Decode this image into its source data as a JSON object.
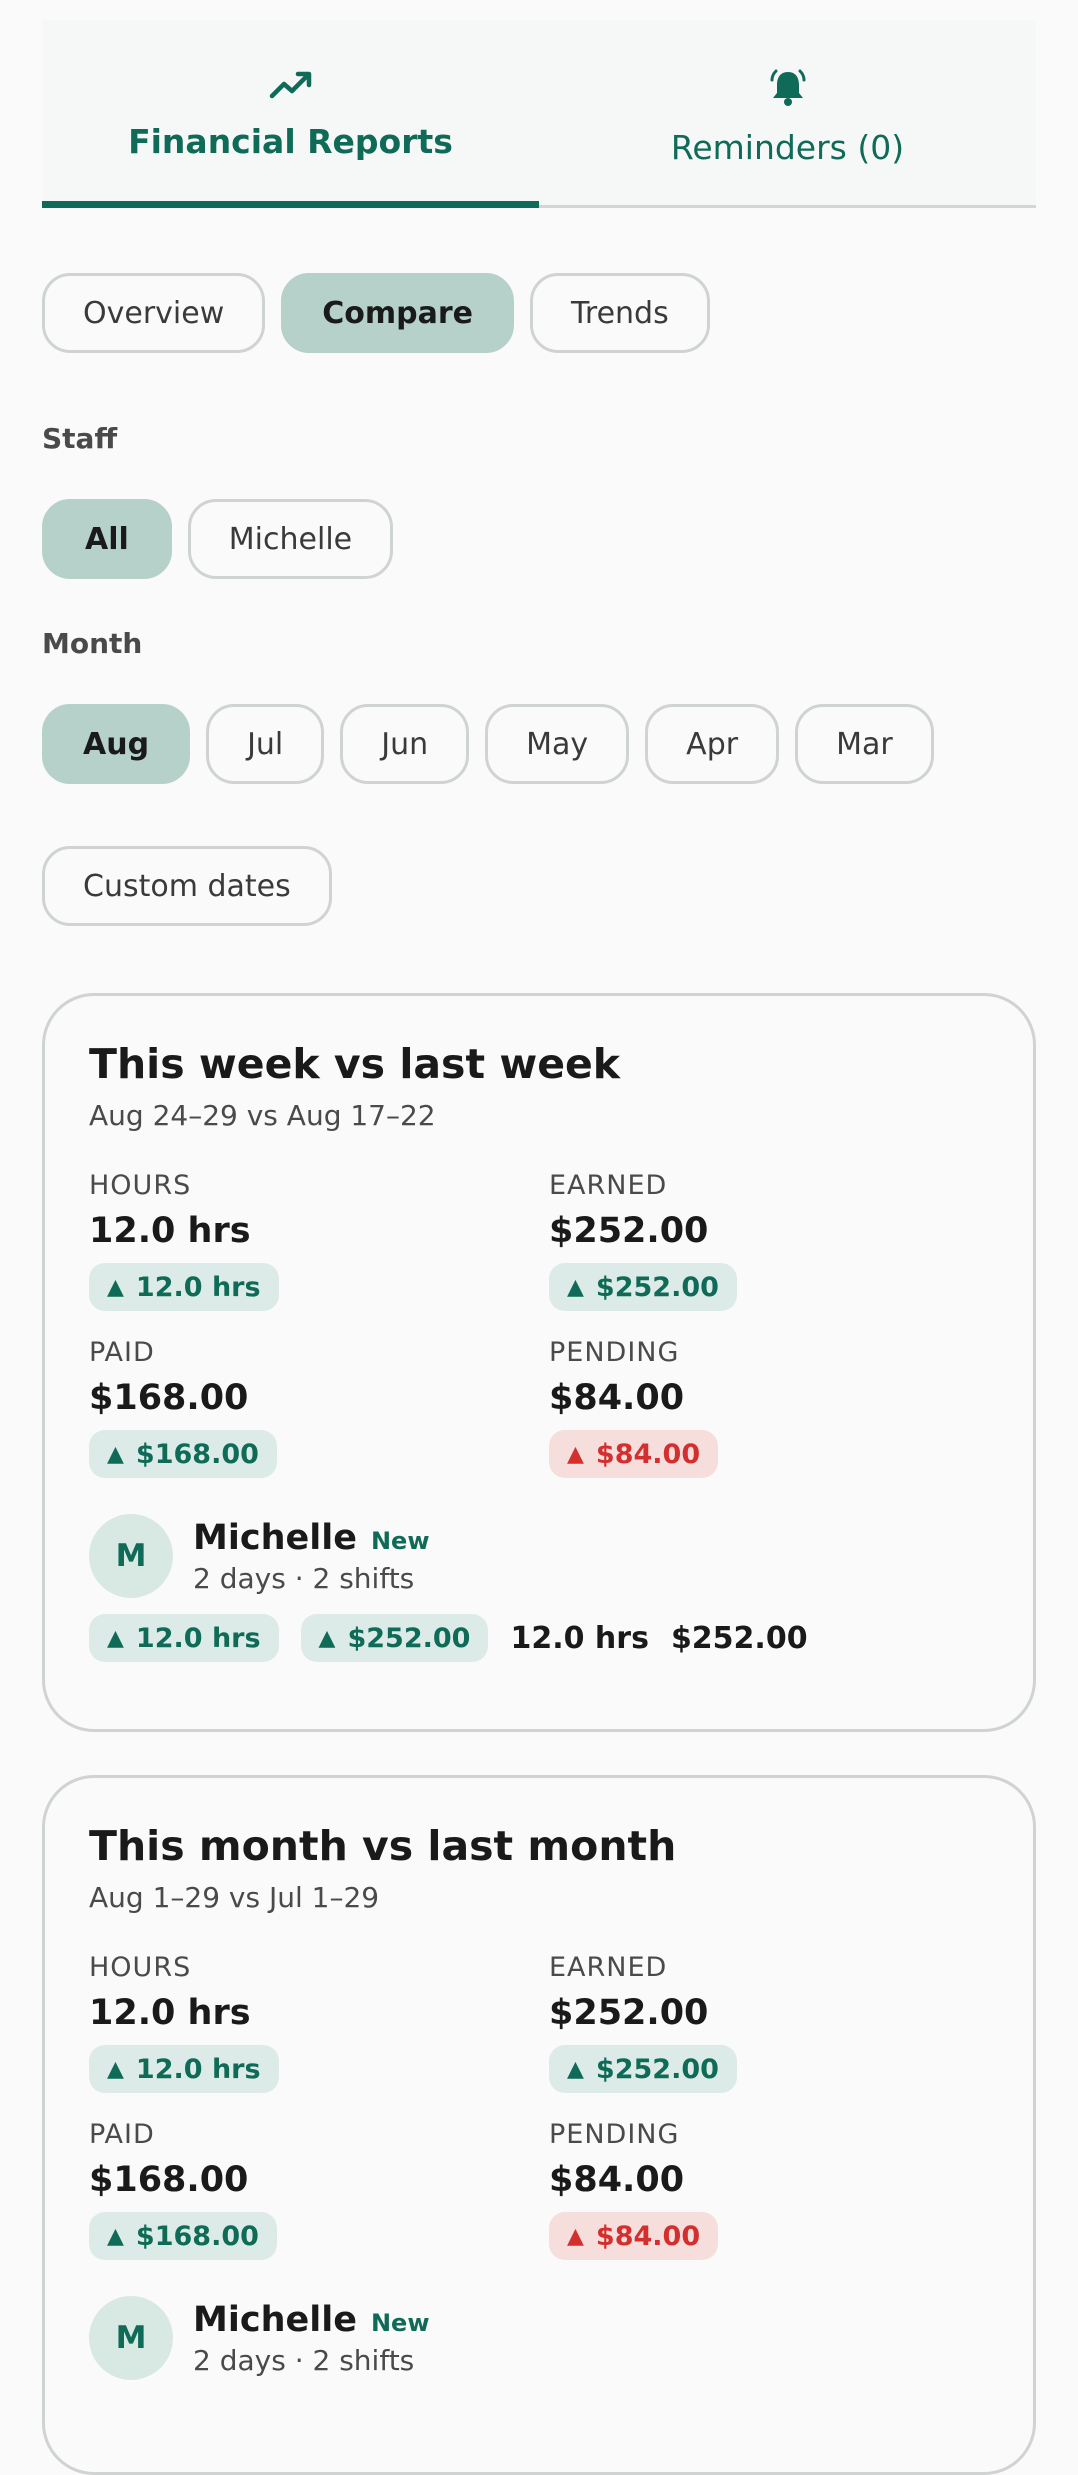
{
  "tabs": [
    {
      "label": "Financial Reports",
      "icon": "trending-up-icon",
      "active": true
    },
    {
      "label": "Reminders (0)",
      "icon": "bell-ringing-icon",
      "active": false
    }
  ],
  "view_chips": [
    "Overview",
    "Compare",
    "Trends"
  ],
  "view_selected": "Compare",
  "staff": {
    "label": "Staff",
    "options": [
      "All",
      "Michelle"
    ],
    "selected": "All"
  },
  "month": {
    "label": "Month",
    "options": [
      "Aug",
      "Jul",
      "Jun",
      "May",
      "Apr",
      "Mar"
    ],
    "selected": "Aug",
    "custom_label": "Custom dates"
  },
  "colors": {
    "accent": "#0f6b57",
    "chip_selected": "#b5d1ca",
    "up_badge_bg": "#dcebe7",
    "warn_badge_bg": "#f6dedd",
    "warn_text": "#d42f2f"
  },
  "cards": [
    {
      "title": "This week vs last week",
      "subtitle": "Aug 24–29 vs Aug 17–22",
      "hours": {
        "label": "HOURS",
        "value": "12.0 hrs",
        "delta": "12.0 hrs"
      },
      "earned": {
        "label": "EARNED",
        "value": "$252.00",
        "delta": "$252.00"
      },
      "paid": {
        "label": "PAID",
        "value": "$168.00",
        "delta": "$168.00"
      },
      "pending": {
        "label": "PENDING",
        "value": "$84.00",
        "delta": "$84.00"
      },
      "staff_row": {
        "initial": "M",
        "name": "Michelle",
        "tag": "New",
        "meta": "2 days · 2 shifts",
        "hours_delta": "12.0 hrs",
        "earned_delta": "$252.00",
        "hours": "12.0 hrs",
        "earned": "$252.00"
      }
    },
    {
      "title": "This month vs last month",
      "subtitle": "Aug 1–29 vs Jul 1–29",
      "hours": {
        "label": "HOURS",
        "value": "12.0 hrs",
        "delta": "12.0 hrs"
      },
      "earned": {
        "label": "EARNED",
        "value": "$252.00",
        "delta": "$252.00"
      },
      "paid": {
        "label": "PAID",
        "value": "$168.00",
        "delta": "$168.00"
      },
      "pending": {
        "label": "PENDING",
        "value": "$84.00",
        "delta": "$84.00"
      },
      "staff_row": {
        "initial": "M",
        "name": "Michelle",
        "tag": "New",
        "meta": "2 days · 2 shifts"
      }
    }
  ]
}
